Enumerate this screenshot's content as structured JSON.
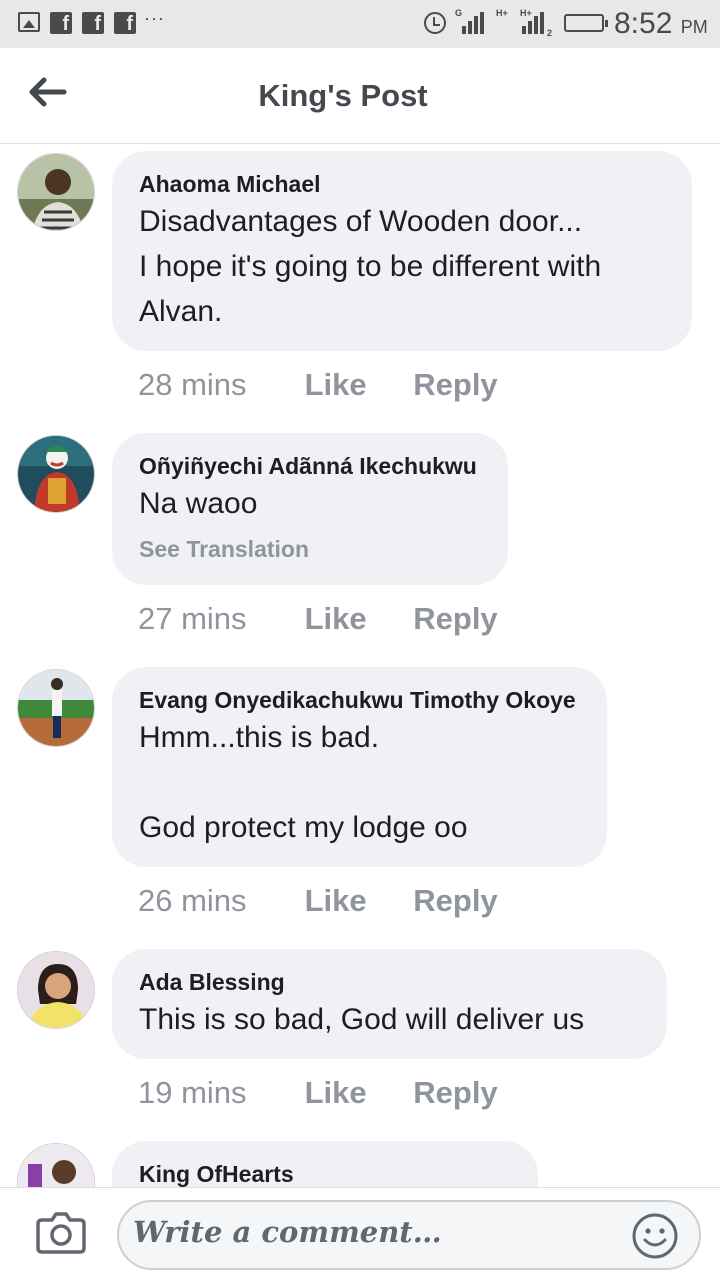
{
  "status_bar": {
    "time": "8:52",
    "ampm": "PM",
    "net1": "G",
    "net2": "H+",
    "net3": "H+",
    "sim": "2",
    "icons": [
      "gallery-icon",
      "facebook-icon",
      "facebook-icon",
      "facebook-icon",
      "more-dots-icon",
      "alarm-icon",
      "signal-icon",
      "signal-icon",
      "battery-icon"
    ]
  },
  "header": {
    "title": "King's Post",
    "back_icon": "back-arrow-icon"
  },
  "comments": [
    {
      "author": "Ahaoma Michael",
      "text": "Disadvantages of Wooden door...\nI hope it's going to be different with\nAlvan.",
      "time": "28 mins",
      "like": "Like",
      "reply": "Reply"
    },
    {
      "author": "Oñyiñyechi Adãnná Ikechukwu",
      "text": "Na waoo",
      "translation": "See Translation",
      "time": "27 mins",
      "like": "Like",
      "reply": "Reply"
    },
    {
      "author": "Evang Onyedikachukwu Timothy Okoye",
      "text": "Hmm...this is bad.\n\nGod protect my lodge oo",
      "time": "26 mins",
      "like": "Like",
      "reply": "Reply"
    },
    {
      "author": "Ada Blessing",
      "text": "This is so bad, God will deliver us",
      "time": "19 mins",
      "like": "Like",
      "reply": "Reply"
    },
    {
      "author": "King OfHearts"
    }
  ],
  "composer": {
    "placeholder": "Write a comment…",
    "camera_icon": "camera-icon",
    "emoji_icon": "smiley-icon"
  },
  "colors": {
    "status_bar_bg": "#e8e8ea",
    "bubble_bg": "#f0f1f4",
    "meta_text": "#90949c",
    "title_text": "#444950"
  }
}
